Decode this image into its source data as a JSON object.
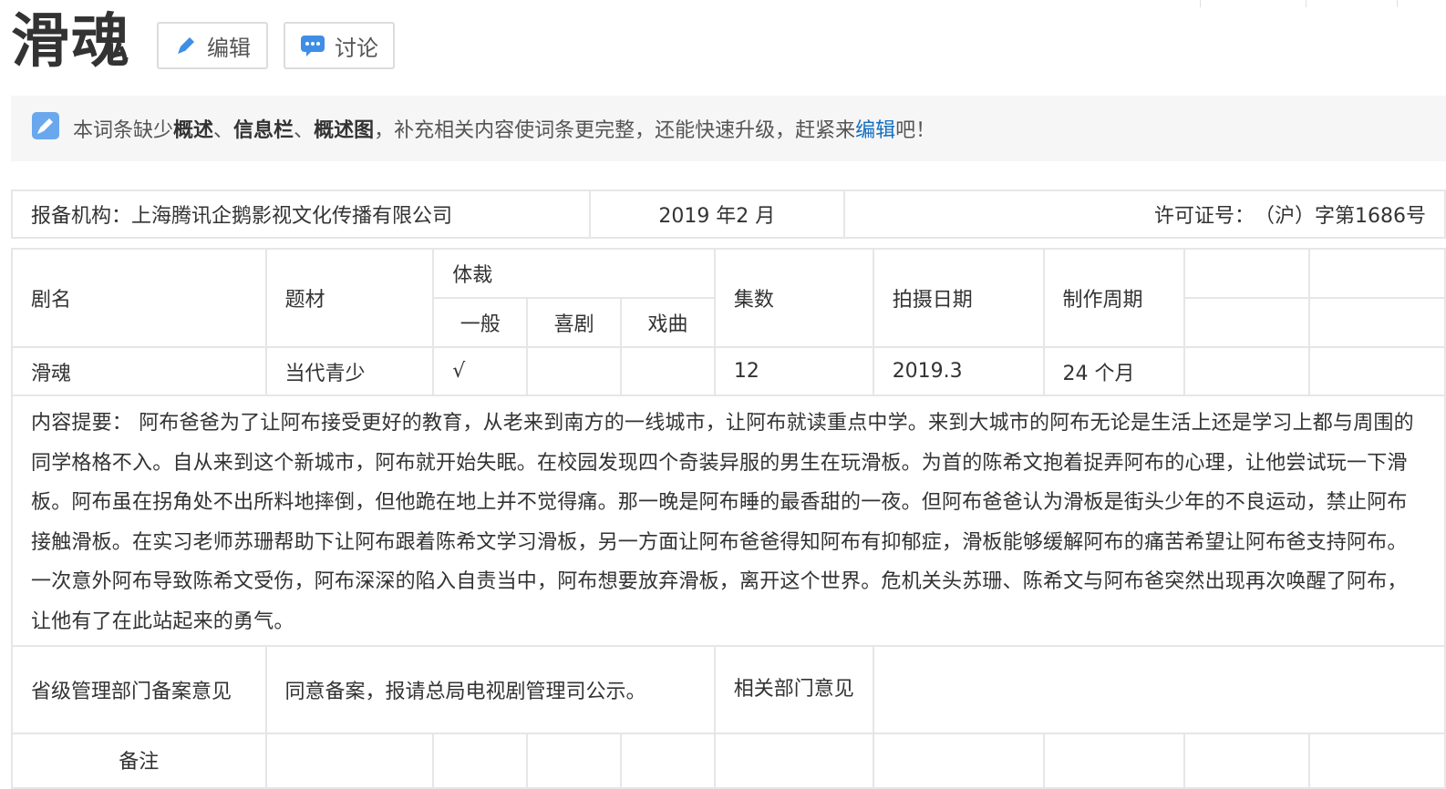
{
  "page": {
    "title": "滑魂",
    "edit_button": "编辑",
    "discuss_button": "讨论"
  },
  "notice": {
    "prefix": "本词条缺少",
    "item1": "概述",
    "sep1": "、",
    "item2": "信息栏",
    "sep2": "、",
    "item3": "概述图",
    "middle": "，补充相关内容使词条更完整，还能快速升级，赶紧来",
    "link": "编辑",
    "suffix": "吧！"
  },
  "info_bar": {
    "org": "报备机构：上海腾讯企鹅影视文化传播有限公司",
    "date": "2019 年2 月",
    "license": "许可证号：　（沪）字第1686号"
  },
  "table": {
    "headers": {
      "name": "剧名",
      "theme": "题材",
      "genre": "体裁",
      "genre_general": "一般",
      "genre_comedy": "喜剧",
      "genre_opera": "戏曲",
      "episodes": "集数",
      "shoot_date": "拍摄日期",
      "production_period": "制作周期"
    },
    "row": {
      "name": "滑魂",
      "theme": "当代青少",
      "genre_general": "√",
      "genre_comedy": "",
      "genre_opera": "",
      "episodes": "12",
      "shoot_date": "2019.3",
      "production_period": "24 个月"
    },
    "summary": "内容提要： 阿布爸爸为了让阿布接受更好的教育，从老来到南方的一线城市，让阿布就读重点中学。来到大城市的阿布无论是生活上还是学习上都与周围的同学格格不入。自从来到这个新城市，阿布就开始失眠。在校园发现四个奇装异服的男生在玩滑板。为首的陈希文抱着捉弄阿布的心理，让他尝试玩一下滑板。阿布虽在拐角处不出所料地摔倒，但他跪在地上并不觉得痛。那一晚是阿布睡的最香甜的一夜。但阿布爸爸认为滑板是街头少年的不良运动，禁止阿布接触滑板。在实习老师苏珊帮助下让阿布跟着陈希文学习滑板，另一方面让阿布爸爸得知阿布有抑郁症，滑板能够缓解阿布的痛苦希望让阿布爸支持阿布。一次意外阿布导致陈希文受伤，阿布深深的陷入自责当中，阿布想要放弃滑板，离开这个世界。危机关头苏珊、陈希文与阿布爸突然出现再次唤醒了阿布，让他有了在此站起来的勇气。",
    "provincial_label": "省级管理部门备案意见",
    "provincial_value": "同意备案，报请总局电视剧管理司公示。",
    "dept_label": "相关部门意见",
    "dept_value": "",
    "remarks_label": "备注"
  },
  "colors": {
    "link": "#136ec2",
    "border": "#e6e6e6",
    "notice_bg": "#f6f6f6",
    "icon_blue": "#3f8ee6"
  },
  "icons": {
    "edit": "pencil-icon",
    "discuss": "chat-bubble-icon",
    "notice": "edit-note-icon"
  }
}
